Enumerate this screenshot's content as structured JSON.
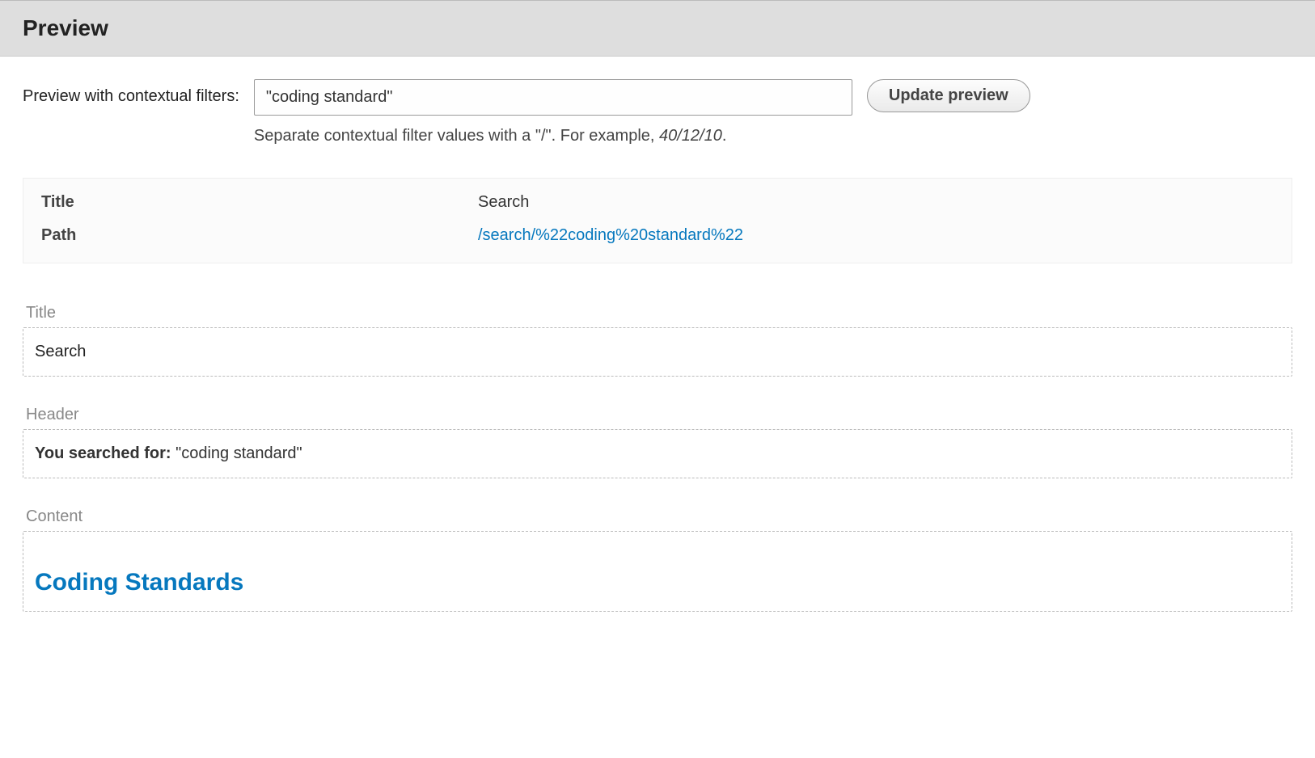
{
  "header": {
    "title": "Preview"
  },
  "filter": {
    "label": "Preview with contextual filters:",
    "value": "\"coding standard\"",
    "hint_prefix": "Separate contextual filter values with a \"/\". For example, ",
    "hint_example": "40/12/10",
    "hint_suffix": ".",
    "button": "Update preview"
  },
  "info": {
    "title_label": "Title",
    "title_value": "Search",
    "path_label": "Path",
    "path_value": "/search/%22coding%20standard%22"
  },
  "sections": {
    "title_label": "Title",
    "title_value": "Search",
    "header_label": "Header",
    "header_bold": "You searched for:",
    "header_rest": " \"coding standard\"",
    "content_label": "Content",
    "result_heading": "Coding Standards"
  }
}
